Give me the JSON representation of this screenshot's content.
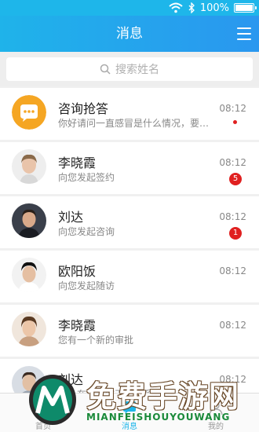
{
  "status_bar": {
    "battery": "100%",
    "battery_level": 1.0
  },
  "header": {
    "title": "消息"
  },
  "search": {
    "placeholder": "搜索姓名"
  },
  "conversations": [
    {
      "name": "咨询抢答",
      "preview": "你好请问一直感冒是什么情况，要…",
      "time": "08:12",
      "unread": ""
    },
    {
      "name": "李晓霞",
      "preview": "向您发起签约",
      "time": "08:12",
      "unread": "5"
    },
    {
      "name": "刘达",
      "preview": "向您发起咨询",
      "time": "08:12",
      "unread": "1"
    },
    {
      "name": "欧阳饭",
      "preview": "向您发起随访",
      "time": "08:12",
      "unread": ""
    },
    {
      "name": "李晓霞",
      "preview": "您有一个新的审批",
      "time": "08:12",
      "unread": ""
    },
    {
      "name": "刘达",
      "preview": "好，在不，昨天说联系上你",
      "time": "08:12",
      "unread": ""
    }
  ],
  "tabs": [
    {
      "label": "首页",
      "icon": "home-icon"
    },
    {
      "label": "消息",
      "icon": "chat-icon"
    },
    {
      "label": "我的",
      "icon": "user-icon"
    }
  ],
  "watermark": {
    "title": "免费手游网",
    "subtitle": "MIANFEISHOUYOUWANG"
  },
  "colors": {
    "accent": "#1eb6ea",
    "badge": "#e02020",
    "consult_icon": "#f5a623"
  }
}
